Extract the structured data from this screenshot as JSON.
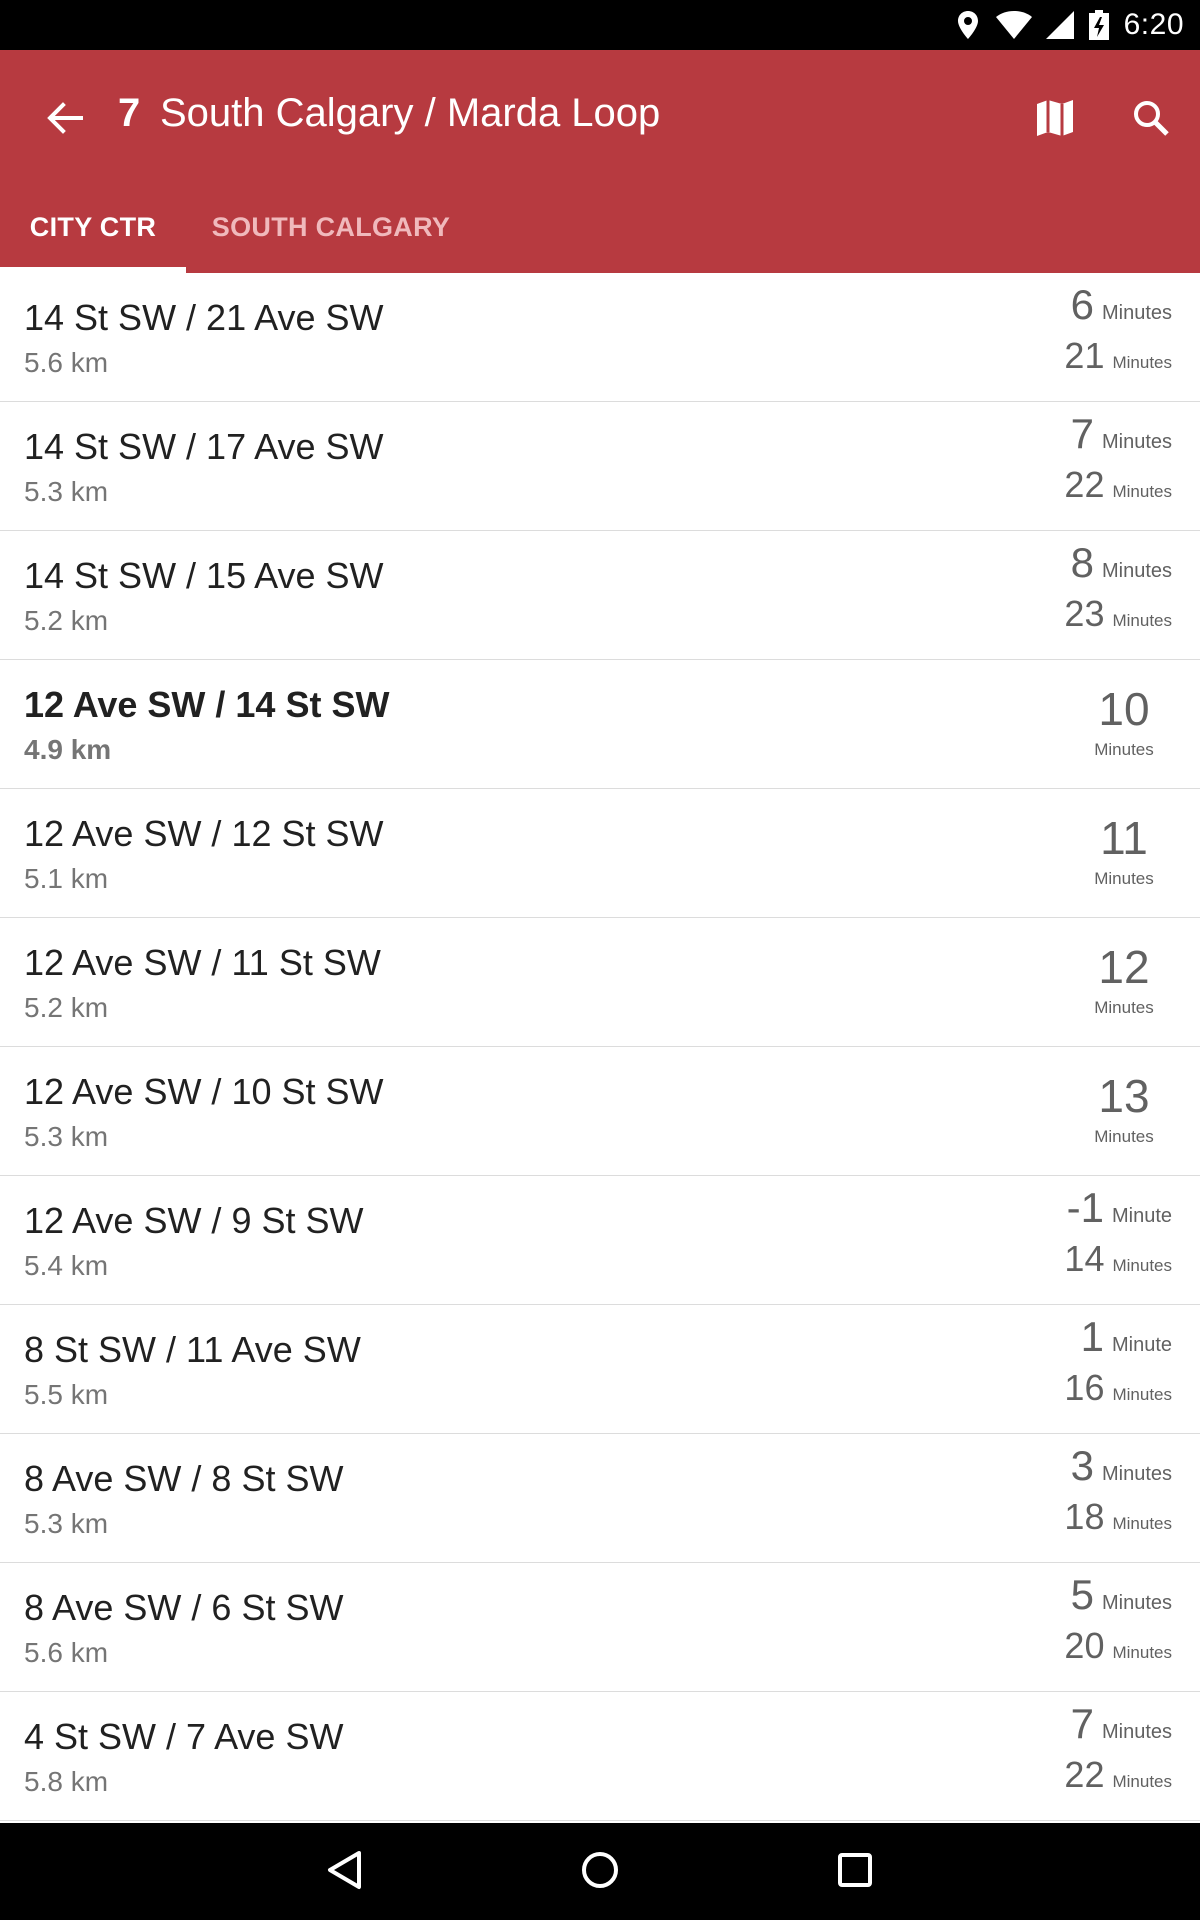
{
  "status_bar": {
    "time": "6:20",
    "icons": [
      "location-icon",
      "wifi-icon",
      "signal-icon",
      "battery-charging-icon"
    ]
  },
  "app_bar": {
    "route_number": "7",
    "route_title": "South Calgary / Marda Loop",
    "background_color": "#b73a40",
    "actions": [
      "back-arrow-icon",
      "map-icon",
      "search-icon"
    ]
  },
  "tabs": [
    {
      "label": "CITY CTR",
      "selected": true
    },
    {
      "label": "SOUTH CALGARY",
      "selected": false
    }
  ],
  "stops": [
    {
      "name": "14 St SW / 21 Ave SW",
      "distance": "5.6 km",
      "times": [
        {
          "num": "6",
          "unit": "Minutes"
        },
        {
          "num": "21",
          "unit": "Minutes"
        }
      ]
    },
    {
      "name": "14 St SW / 17 Ave SW",
      "distance": "5.3 km",
      "times": [
        {
          "num": "7",
          "unit": "Minutes"
        },
        {
          "num": "22",
          "unit": "Minutes"
        }
      ]
    },
    {
      "name": "14 St SW / 15 Ave SW",
      "distance": "5.2 km",
      "times": [
        {
          "num": "8",
          "unit": "Minutes"
        },
        {
          "num": "23",
          "unit": "Minutes"
        }
      ]
    },
    {
      "name": "12 Ave SW / 14 St SW",
      "distance": "4.9 km",
      "bold": true,
      "times": [
        {
          "num": "10",
          "unit": "Minutes"
        }
      ]
    },
    {
      "name": "12 Ave SW / 12 St SW",
      "distance": "5.1 km",
      "times": [
        {
          "num": "11",
          "unit": "Minutes"
        }
      ]
    },
    {
      "name": "12 Ave SW / 11 St SW",
      "distance": "5.2 km",
      "times": [
        {
          "num": "12",
          "unit": "Minutes"
        }
      ]
    },
    {
      "name": "12 Ave SW / 10 St SW",
      "distance": "5.3 km",
      "times": [
        {
          "num": "13",
          "unit": "Minutes"
        }
      ]
    },
    {
      "name": "12 Ave SW / 9 St SW",
      "distance": "5.4 km",
      "times": [
        {
          "num": "-1",
          "unit": "Minute"
        },
        {
          "num": "14",
          "unit": "Minutes"
        }
      ]
    },
    {
      "name": "8 St SW / 11 Ave SW",
      "distance": "5.5 km",
      "times": [
        {
          "num": "1",
          "unit": "Minute"
        },
        {
          "num": "16",
          "unit": "Minutes"
        }
      ]
    },
    {
      "name": "8 Ave SW / 8 St SW",
      "distance": "5.3 km",
      "times": [
        {
          "num": "3",
          "unit": "Minutes"
        },
        {
          "num": "18",
          "unit": "Minutes"
        }
      ]
    },
    {
      "name": "8 Ave SW / 6 St SW",
      "distance": "5.6 km",
      "times": [
        {
          "num": "5",
          "unit": "Minutes"
        },
        {
          "num": "20",
          "unit": "Minutes"
        }
      ]
    },
    {
      "name": "4 St SW / 7 Ave SW",
      "distance": "5.8 km",
      "times": [
        {
          "num": "7",
          "unit": "Minutes"
        },
        {
          "num": "22",
          "unit": "Minutes"
        }
      ]
    }
  ],
  "nav_bar": {
    "buttons": [
      "nav-back-icon",
      "nav-home-icon",
      "nav-recents-icon"
    ]
  }
}
